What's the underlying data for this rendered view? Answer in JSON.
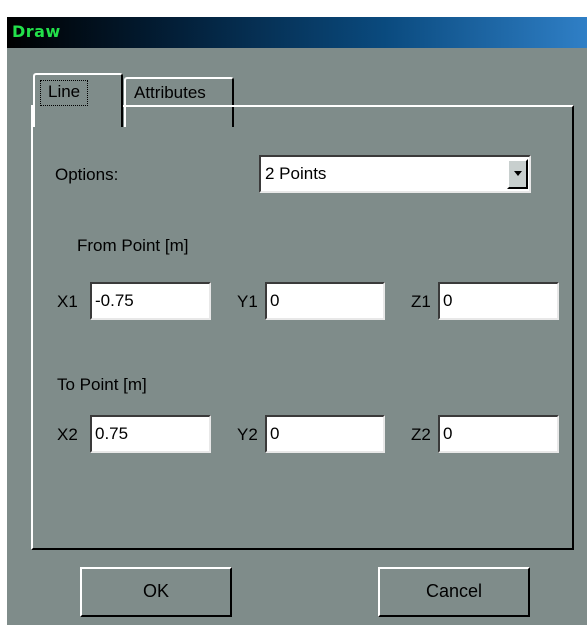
{
  "window": {
    "title": "Draw"
  },
  "tabs": [
    {
      "label": "Line",
      "active": true
    },
    {
      "label": "Attributes",
      "active": false
    }
  ],
  "options": {
    "label": "Options:",
    "selected": "2 Points"
  },
  "from_point": {
    "heading": "From Point [m]",
    "x_label": "X1",
    "x_value": "-0.75",
    "y_label": "Y1",
    "y_value": "0",
    "z_label": "Z1",
    "z_value": "0"
  },
  "to_point": {
    "heading": "To Point [m]",
    "x_label": "X2",
    "x_value": "0.75",
    "y_label": "Y2",
    "y_value": "0",
    "z_label": "Z2",
    "z_value": "0"
  },
  "buttons": {
    "ok": "OK",
    "cancel": "Cancel"
  },
  "colors": {
    "dialog_bg": "#7f8c8a",
    "title_text": "#23e04a",
    "titlebar_gradient_end": "#2f7fc6"
  },
  "icons": {
    "dropdown": "chevron-down-icon"
  }
}
